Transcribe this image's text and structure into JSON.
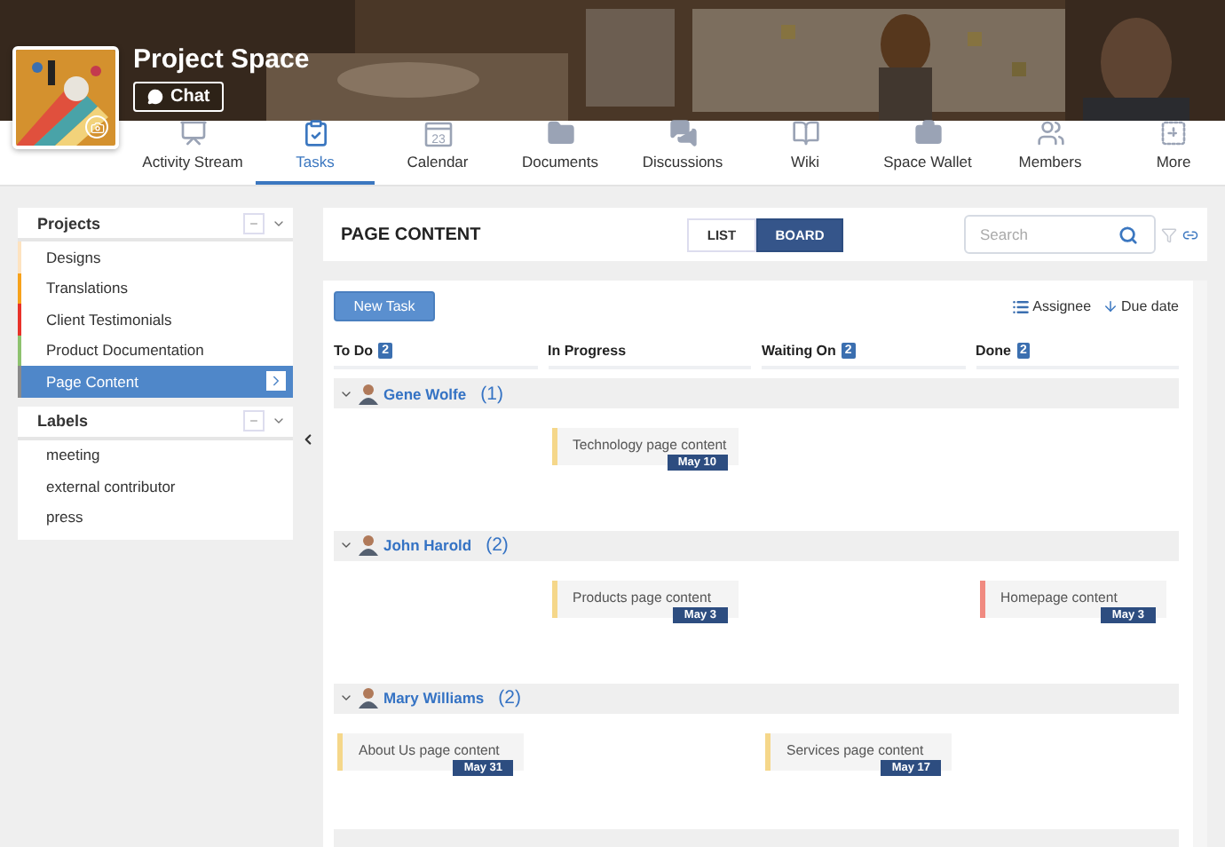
{
  "space": {
    "title": "Project Space",
    "chat_button": "Chat"
  },
  "nav": [
    {
      "label": "Activity Stream",
      "selected": false
    },
    {
      "label": "Tasks",
      "selected": true
    },
    {
      "label": "Calendar",
      "icon_text": "23",
      "selected": false
    },
    {
      "label": "Documents",
      "selected": false
    },
    {
      "label": "Discussions",
      "selected": false
    },
    {
      "label": "Wiki",
      "selected": false
    },
    {
      "label": "Space Wallet",
      "selected": false
    },
    {
      "label": "Members",
      "selected": false
    },
    {
      "label": "More",
      "selected": false
    }
  ],
  "sidebar": {
    "projects": {
      "title": "Projects",
      "items": [
        {
          "label": "Designs",
          "color": "#fde3c0",
          "selected": false
        },
        {
          "label": "Translations",
          "color": "#f7a21b",
          "selected": false
        },
        {
          "label": "Client Testimonials",
          "color": "#e8322a",
          "selected": false
        },
        {
          "label": "Product Documentation",
          "color": "#8dc26f",
          "selected": false
        },
        {
          "label": "Page Content",
          "color": "#8a8a8a",
          "selected": true
        }
      ]
    },
    "labels": {
      "title": "Labels",
      "items": [
        {
          "label": "meeting"
        },
        {
          "label": "external contributor"
        },
        {
          "label": "press"
        }
      ]
    }
  },
  "board": {
    "title": "PAGE CONTENT",
    "views": [
      {
        "label": "LIST",
        "selected": false
      },
      {
        "label": "BOARD",
        "selected": true
      }
    ],
    "search": {
      "placeholder": "Search"
    },
    "new_task": "New Task",
    "group_by": "Assignee",
    "sort_by": "Due date",
    "columns": [
      {
        "name": "To Do",
        "count": "2"
      },
      {
        "name": "In Progress"
      },
      {
        "name": "Waiting On",
        "count": "2"
      },
      {
        "name": "Done",
        "count": "2"
      }
    ],
    "groups": [
      {
        "name": "Gene Wolfe",
        "count": "(1)",
        "expanded": true,
        "cells": [
          null,
          {
            "title": "Technology page content",
            "due": "May 10",
            "color": "#f5d78a"
          },
          null,
          null
        ]
      },
      {
        "name": "John Harold",
        "count": "(2)",
        "expanded": true,
        "cells": [
          null,
          {
            "title": "Products page content",
            "due": "May 3",
            "color": "#f5d78a"
          },
          null,
          {
            "title": "Homepage content",
            "due": "May 3",
            "color": "#f08a80"
          }
        ]
      },
      {
        "name": "Mary Williams",
        "count": "(2)",
        "expanded": true,
        "cells": [
          {
            "title": "About Us page content",
            "due": "May 31",
            "color": "#f5d78a"
          },
          null,
          {
            "title": "Services page content",
            "due": "May 17",
            "color": "#f5d78a"
          },
          null
        ]
      }
    ]
  }
}
